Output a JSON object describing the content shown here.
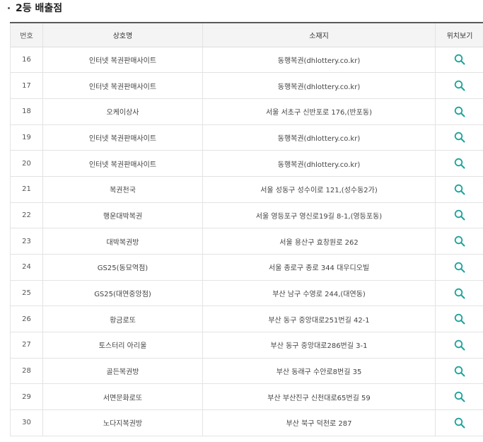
{
  "section": {
    "title": "2등 배출점"
  },
  "table": {
    "headers": {
      "no": "번호",
      "store": "상호명",
      "addr": "소재지",
      "loc": "위치보기"
    },
    "rows": [
      {
        "no": "16",
        "store": "인터넷 복권판매사이트",
        "addr": "동행복권(dhlottery.co.kr)"
      },
      {
        "no": "17",
        "store": "인터넷 복권판매사이트",
        "addr": "동행복권(dhlottery.co.kr)"
      },
      {
        "no": "18",
        "store": "오케이상사",
        "addr": "서울 서초구 신반포로 176,(반포동)"
      },
      {
        "no": "19",
        "store": "인터넷 복권판매사이트",
        "addr": "동행복권(dhlottery.co.kr)"
      },
      {
        "no": "20",
        "store": "인터넷 복권판매사이트",
        "addr": "동행복권(dhlottery.co.kr)"
      },
      {
        "no": "21",
        "store": "복권천국",
        "addr": "서울 성동구 성수이로 121,(성수동2가)"
      },
      {
        "no": "22",
        "store": "행운대박복권",
        "addr": "서울 영등포구 영신로19길 8-1,(영등포동)"
      },
      {
        "no": "23",
        "store": "대박복권방",
        "addr": "서울 용산구 효창원로 262"
      },
      {
        "no": "24",
        "store": "GS25(동묘역점)",
        "addr": "서울 종로구 종로 344 대우디오빌"
      },
      {
        "no": "25",
        "store": "GS25(대연중앙점)",
        "addr": "부산 남구 수영로 244,(대연동)"
      },
      {
        "no": "26",
        "store": "황금로또",
        "addr": "부산 동구 중앙대로251번길 42-1"
      },
      {
        "no": "27",
        "store": "토스터리 아리울",
        "addr": "부산 동구 중앙대로286번길 3-1"
      },
      {
        "no": "28",
        "store": "골든복권방",
        "addr": "부산 동래구 수안로8번길 35"
      },
      {
        "no": "29",
        "store": "서면문화로또",
        "addr": "부산 부산진구 신천대로65번길 59"
      },
      {
        "no": "30",
        "store": "노다지복권방",
        "addr": "부산 북구 덕천로 287"
      }
    ]
  },
  "colors": {
    "search_icon": "#1aa39a",
    "header_border": "#5a5a5a"
  },
  "icons": {
    "location": "search-icon"
  }
}
